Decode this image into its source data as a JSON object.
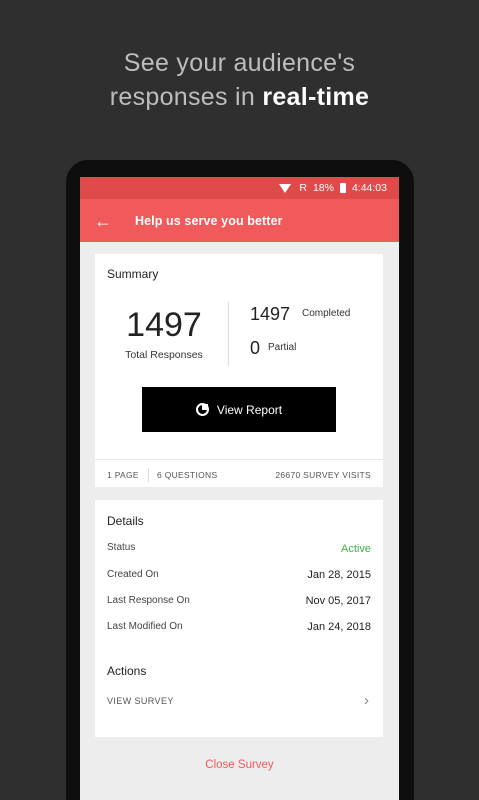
{
  "promo": {
    "line1": "See your audience's",
    "line2_prefix": "responses in ",
    "line2_bold": "real-time"
  },
  "status_bar": {
    "network": "R",
    "battery": "18%",
    "time": "4:44:03"
  },
  "app_bar": {
    "back_icon": "←",
    "title": "Help us serve you better"
  },
  "summary": {
    "title": "Summary",
    "total_responses": "1497",
    "total_label": "Total Responses",
    "completed_value": "1497",
    "completed_label": "Completed",
    "partial_value": "0",
    "partial_label": "Partial",
    "view_report_label": "View Report",
    "pages": "1 PAGE",
    "questions": "6 QUESTIONS",
    "visits": "26670 SURVEY VISITS"
  },
  "details": {
    "title": "Details",
    "rows": [
      {
        "label": "Status",
        "value": "Active"
      },
      {
        "label": "Created On",
        "value": "Jan 28, 2015"
      },
      {
        "label": "Last Response On",
        "value": "Nov 05, 2017"
      },
      {
        "label": "Last Modified On",
        "value": "Jan 24, 2018"
      }
    ],
    "actions_title": "Actions",
    "view_survey_label": "VIEW SURVEY",
    "chevron": "›"
  },
  "close_survey_label": "Close Survey",
  "colors": {
    "accent": "#f05a5a",
    "status_active": "#3bb34a",
    "background": "#2f2f2f"
  }
}
